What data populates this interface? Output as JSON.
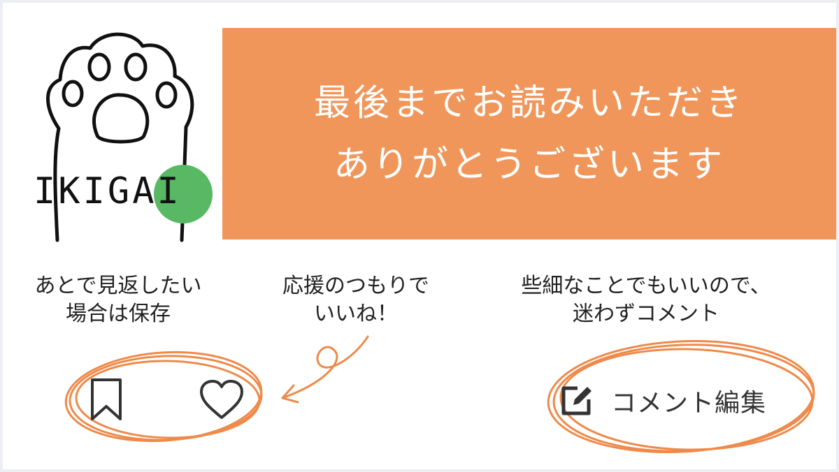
{
  "logo": {
    "text": "IKIGAI",
    "icon": "cat-paw-icon",
    "accent_color": "#58b863"
  },
  "banner": {
    "line1": "最後までお読みいただき",
    "line2": "ありがとうございます",
    "background_color": "#f0965a"
  },
  "notes": {
    "save": {
      "line1": "あとで見返したい",
      "line2": "場合は保存"
    },
    "like": {
      "line1": "応援のつもりで",
      "line2": "いいね！"
    },
    "comment": {
      "line1": "些細なことでもいいので、",
      "line2": "迷わずコメント"
    }
  },
  "actions": {
    "save_icon": "bookmark-icon",
    "like_icon": "heart-icon",
    "comment_icon": "edit-icon",
    "comment_label": "コメント編集"
  },
  "highlight_color": "#ee8a4a"
}
